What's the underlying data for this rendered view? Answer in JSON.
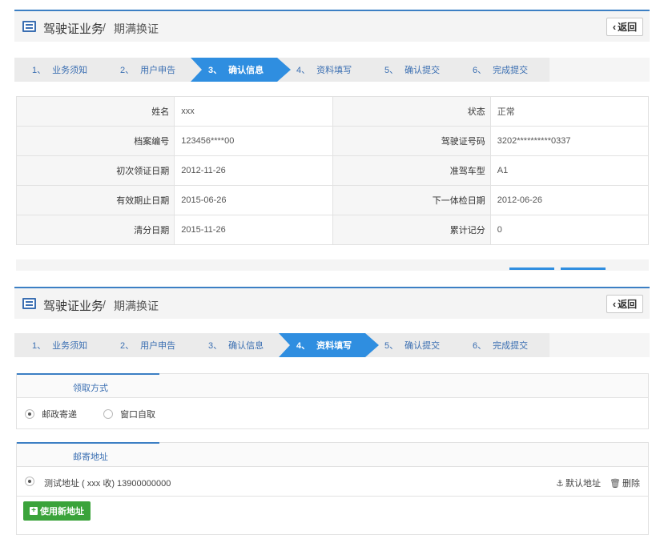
{
  "panel1": {
    "title_main": "驾驶证业务",
    "title_sep": "/",
    "title_sub": "期满换证",
    "back_label": "返回",
    "steps": [
      {
        "num": "1、",
        "label": "业务须知"
      },
      {
        "num": "2、",
        "label": "用户申告"
      },
      {
        "num": "3、",
        "label": "确认信息"
      },
      {
        "num": "4、",
        "label": "资料填写"
      },
      {
        "num": "5、",
        "label": "确认提交"
      },
      {
        "num": "6、",
        "label": "完成提交"
      }
    ],
    "active_step": 3,
    "info_rows": [
      {
        "l1": "姓名",
        "v1": "xxx",
        "l2": "状态",
        "v2": "正常"
      },
      {
        "l1": "档案编号",
        "v1": "123456****00",
        "l2": "驾驶证号码",
        "v2": "3202**********0337"
      },
      {
        "l1": "初次领证日期",
        "v1": "2012-11-26",
        "l2": "准驾车型",
        "v2": "A1"
      },
      {
        "l1": "有效期止日期",
        "v1": "2015-06-26",
        "l2": "下一体检日期",
        "v2": "2012-06-26"
      },
      {
        "l1": "清分日期",
        "v1": "2015-11-26",
        "l2": "累计记分",
        "v2": "0"
      }
    ]
  },
  "panel2": {
    "title_main": "驾驶证业务",
    "title_sep": "/",
    "title_sub": "期满换证",
    "back_label": "返回",
    "steps": [
      {
        "num": "1、",
        "label": "业务须知"
      },
      {
        "num": "2、",
        "label": "用户申告"
      },
      {
        "num": "3、",
        "label": "确认信息"
      },
      {
        "num": "4、",
        "label": "资料填写"
      },
      {
        "num": "5、",
        "label": "确认提交"
      },
      {
        "num": "6、",
        "label": "完成提交"
      }
    ],
    "active_step": 4,
    "pickup": {
      "title": "领取方式",
      "option_mail": "邮政寄递",
      "option_window": "窗口自取"
    },
    "address": {
      "title": "邮寄地址",
      "entry": "测试地址 ( xxx 收)  13900000000",
      "default_label": "默认地址",
      "delete_label": "删除",
      "use_new_label": "使用新地址"
    }
  }
}
